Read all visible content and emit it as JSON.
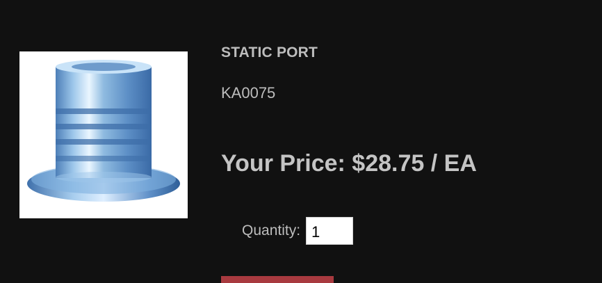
{
  "product": {
    "title": "STATIC PORT",
    "sku": "KA0075",
    "price_label": "Your Price: $28.75 / EA",
    "image_icon": "static-port-fitting"
  },
  "quantity": {
    "label": "Quantity:",
    "value": "1"
  },
  "colors": {
    "background": "#111111",
    "text": "#bdbdbd",
    "button": "#a83a3f"
  }
}
